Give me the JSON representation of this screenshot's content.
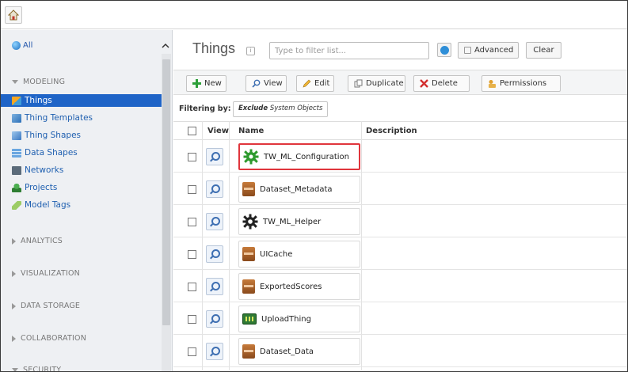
{
  "topbar": {
    "home_icon": "home-icon"
  },
  "sidebar": {
    "all_label": "All",
    "sections": {
      "modeling": "MODELING",
      "analytics": "ANALYTICS",
      "visualization": "VISUALIZATION",
      "data_storage": "DATA STORAGE",
      "collaboration": "COLLABORATION",
      "security": "SECURITY"
    },
    "items": [
      {
        "label": "Things",
        "icon": "things-icon",
        "active": true
      },
      {
        "label": "Thing Templates",
        "icon": "thing-templates-icon"
      },
      {
        "label": "Thing Shapes",
        "icon": "thing-shapes-icon"
      },
      {
        "label": "Data Shapes",
        "icon": "data-shapes-icon"
      },
      {
        "label": "Networks",
        "icon": "networks-icon"
      },
      {
        "label": "Projects",
        "icon": "projects-icon"
      },
      {
        "label": "Model Tags",
        "icon": "model-tags-icon"
      }
    ]
  },
  "main": {
    "title": "Things",
    "filter_placeholder": "Type to filter list...",
    "advanced_label": "Advanced",
    "clear_label": "Clear",
    "toolbar": {
      "new": "New",
      "view": "View",
      "edit": "Edit",
      "duplicate": "Duplicate",
      "delete": "Delete",
      "permissions": "Permissions"
    },
    "filtering_label": "Filtering by:",
    "filter_chip_bold": "Exclude",
    "filter_chip_rest": "System Objects",
    "columns": {
      "view": "View",
      "name": "Name",
      "description": "Description"
    },
    "rows": [
      {
        "name": "TW_ML_Configuration",
        "icon": "green-gear-icon",
        "highlighted": true
      },
      {
        "name": "Dataset_Metadata",
        "icon": "database-icon"
      },
      {
        "name": "TW_ML_Helper",
        "icon": "gear-icon"
      },
      {
        "name": "UICache",
        "icon": "database-icon"
      },
      {
        "name": "ExportedScores",
        "icon": "database-icon"
      },
      {
        "name": "UploadThing",
        "icon": "circuit-board-icon"
      },
      {
        "name": "Dataset_Data",
        "icon": "database-icon"
      }
    ]
  }
}
